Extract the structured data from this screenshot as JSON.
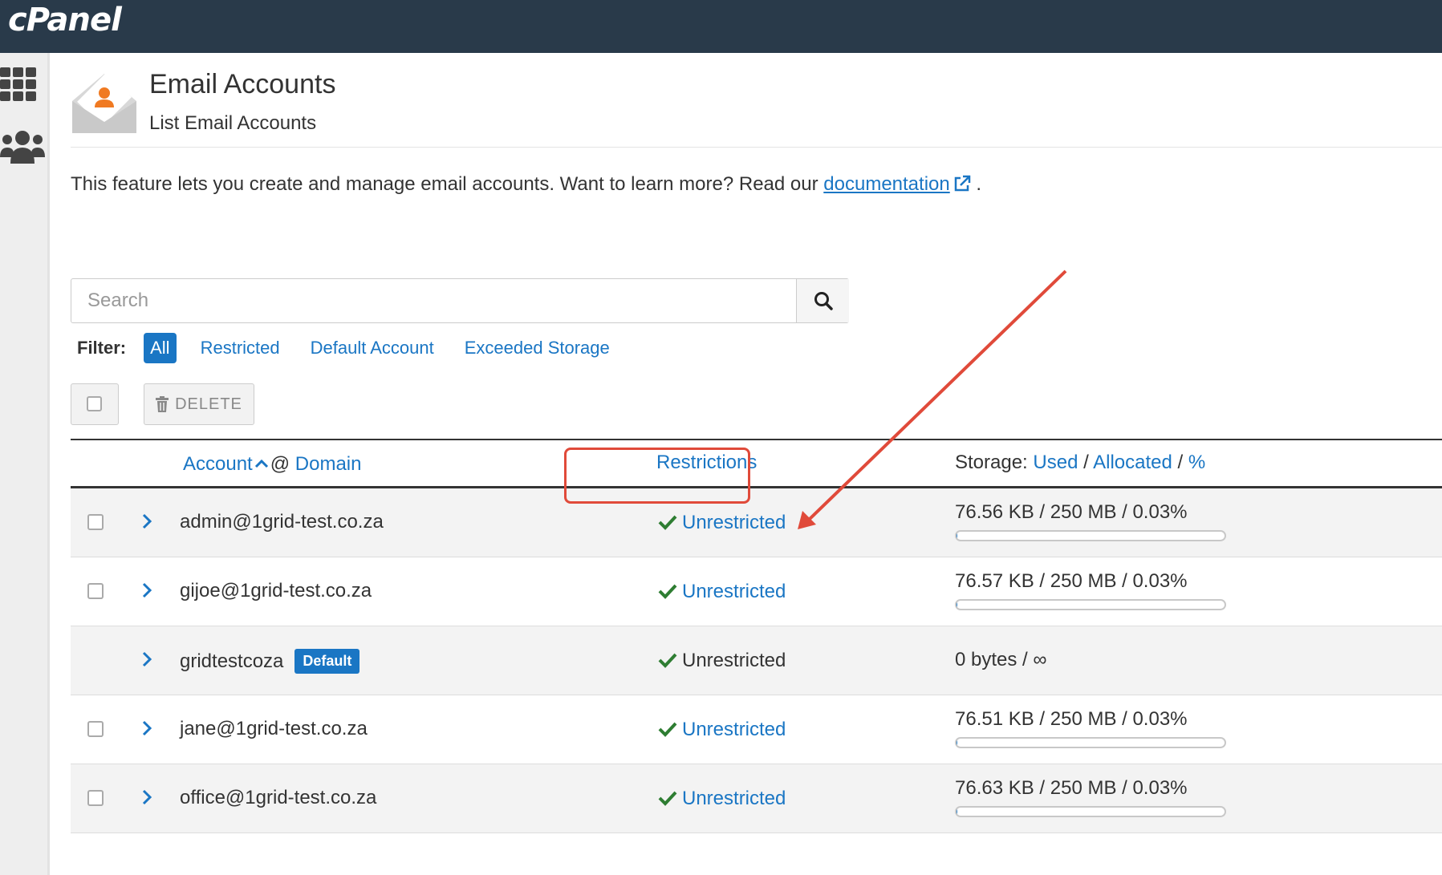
{
  "header": {
    "logo": "cPanel"
  },
  "sidebar": {
    "icons": [
      "apps-grid-icon",
      "users-icon"
    ]
  },
  "page": {
    "title": "Email Accounts",
    "subtitle": "List Email Accounts",
    "intro_text": "This feature lets you create and manage email accounts. Want to learn more? Read our ",
    "intro_link": "documentation",
    "intro_end": "."
  },
  "search": {
    "placeholder": "Search",
    "value": ""
  },
  "filter": {
    "label": "Filter:",
    "options": [
      "All",
      "Restricted",
      "Default Account",
      "Exceeded Storage"
    ],
    "active": "All"
  },
  "toolbar": {
    "delete_label": "DELETE"
  },
  "table": {
    "col_account": "Account",
    "col_at": "@",
    "col_domain": "Domain",
    "col_restrictions": "Restrictions",
    "col_storage_prefix": "Storage:",
    "col_storage_used": "Used",
    "col_storage_sep1": "/",
    "col_storage_allocated": "Allocated",
    "col_storage_sep2": "/",
    "col_storage_pct": "%",
    "rows": [
      {
        "account": "admin@1grid-test.co.za",
        "badge": "",
        "restriction": "Unrestricted",
        "restriction_link": true,
        "storage": "76.56 KB / 250 MB / 0.03%",
        "usage_fraction": 0.0003,
        "has_checkbox": true,
        "alt": true
      },
      {
        "account": "gijoe@1grid-test.co.za",
        "badge": "",
        "restriction": "Unrestricted",
        "restriction_link": true,
        "storage": "76.57 KB / 250 MB / 0.03%",
        "usage_fraction": 0.0003,
        "has_checkbox": true,
        "alt": false
      },
      {
        "account": "gridtestcoza",
        "badge": "Default",
        "restriction": "Unrestricted",
        "restriction_link": false,
        "storage": "0 bytes / ∞",
        "usage_fraction": null,
        "has_checkbox": false,
        "alt": true
      },
      {
        "account": "jane@1grid-test.co.za",
        "badge": "",
        "restriction": "Unrestricted",
        "restriction_link": true,
        "storage": "76.51 KB / 250 MB / 0.03%",
        "usage_fraction": 0.0003,
        "has_checkbox": true,
        "alt": false
      },
      {
        "account": "office@1grid-test.co.za",
        "badge": "",
        "restriction": "Unrestricted",
        "restriction_link": true,
        "storage": "76.63 KB / 250 MB / 0.03%",
        "usage_fraction": 0.0003,
        "has_checkbox": true,
        "alt": true
      }
    ]
  },
  "colors": {
    "topbar": "#293a4a",
    "link": "#1a76c4",
    "annotation": "#e04a3a",
    "check": "#2e7d32"
  }
}
